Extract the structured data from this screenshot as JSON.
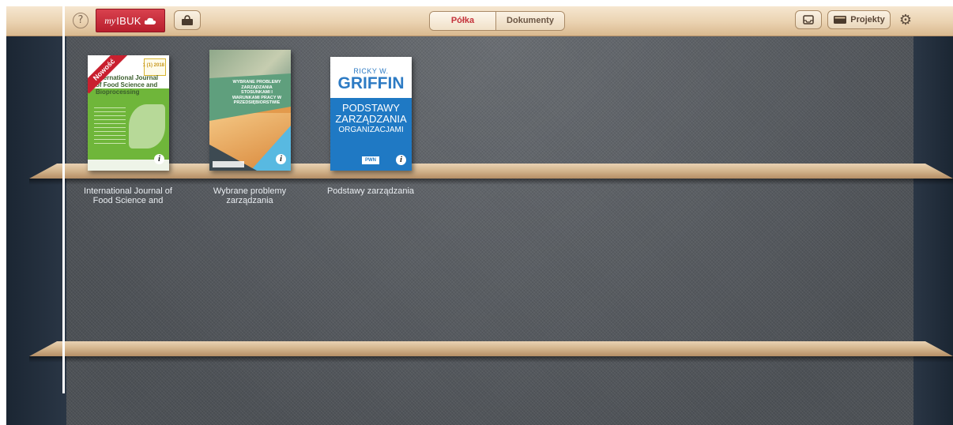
{
  "toolbar": {
    "help_symbol": "?",
    "brand_my": "my",
    "brand_name": "IBUK",
    "tabs": [
      {
        "label": "Półka",
        "active": true
      },
      {
        "label": "Dokumenty",
        "active": false
      }
    ],
    "projects_label": "Projekty",
    "settings_symbol": "⚙"
  },
  "shelf": {
    "books": [
      {
        "caption": "International Journal of Food Science and",
        "cover_badge": "Nowość",
        "cover_title": "International Journal of Food Science and Bioprocessing",
        "cover_issue": "1 (1) 2018"
      },
      {
        "caption": "Wybrane problemy zarządzania",
        "cover_title": "WYBRANE PROBLEMY ZARZĄDZANIA STOSUNKAMI I WARUNKAMI PRACY W PRZEDSIĘBIORSTWIE"
      },
      {
        "caption": "Podstawy zarządzania",
        "cover_author": "RICKY W.",
        "cover_author_surname": "GRIFFIN",
        "cover_line1": "PODSTAWY",
        "cover_line2": "ZARZĄDZANIA",
        "cover_line3": "ORGANIZACJAMI",
        "cover_publisher": "PWN"
      }
    ],
    "info_symbol": "i"
  },
  "colors": {
    "brand_red": "#c4323a",
    "toolbar_wood": "#ead2b0",
    "wall": "#565a5f",
    "shelf_wood": "#d5b790"
  }
}
